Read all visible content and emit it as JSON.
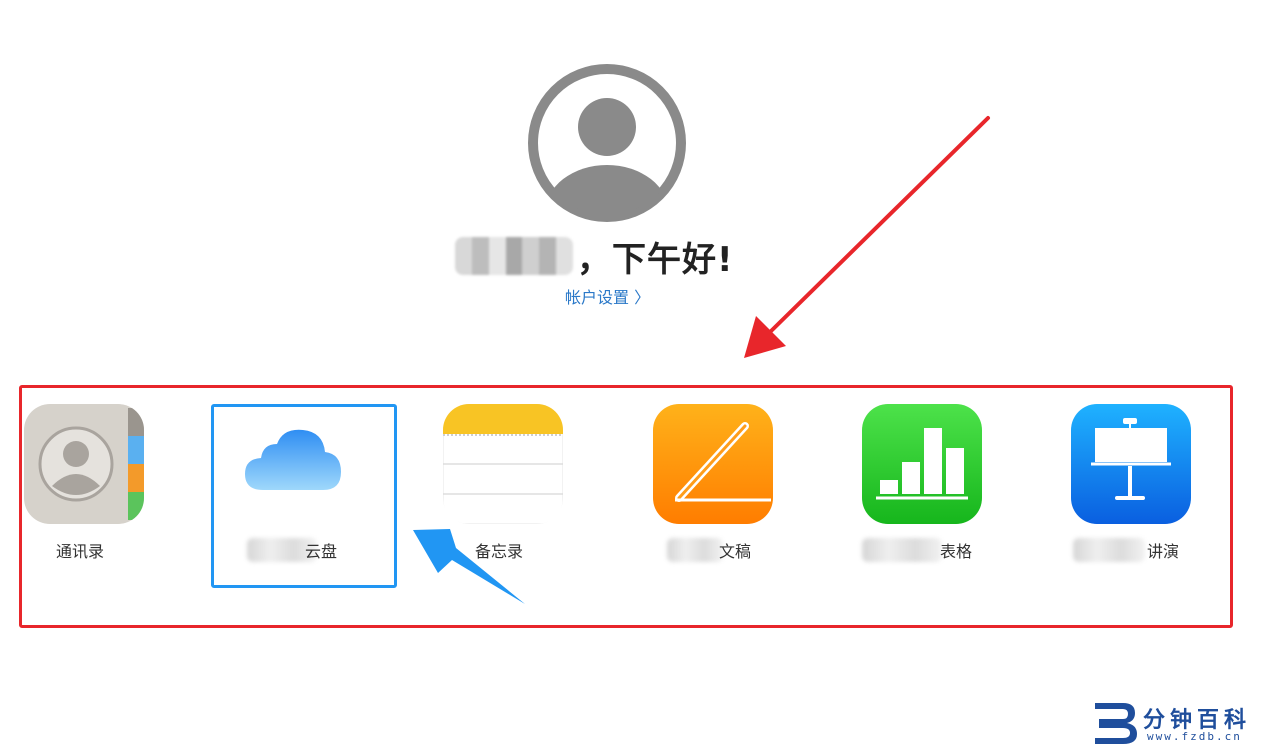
{
  "header": {
    "greeting_suffix": "，下午好!",
    "account_settings": "帐户设置 〉"
  },
  "apps": [
    {
      "label": "通讯录",
      "icon": "contacts-icon"
    },
    {
      "label": "云盘",
      "icon": "icloud-drive-icon"
    },
    {
      "label": "备忘录",
      "icon": "notes-icon"
    },
    {
      "label": "文稿",
      "icon": "pages-icon"
    },
    {
      "label": "表格",
      "icon": "numbers-icon"
    },
    {
      "label": "讲演",
      "icon": "keynote-icon"
    }
  ],
  "annotations": {
    "red_arrow_color": "#e8262b",
    "blue_arrow_color": "#2196f3"
  },
  "watermark": {
    "text": "分钟百科",
    "url": "www.fzdb.cn"
  }
}
